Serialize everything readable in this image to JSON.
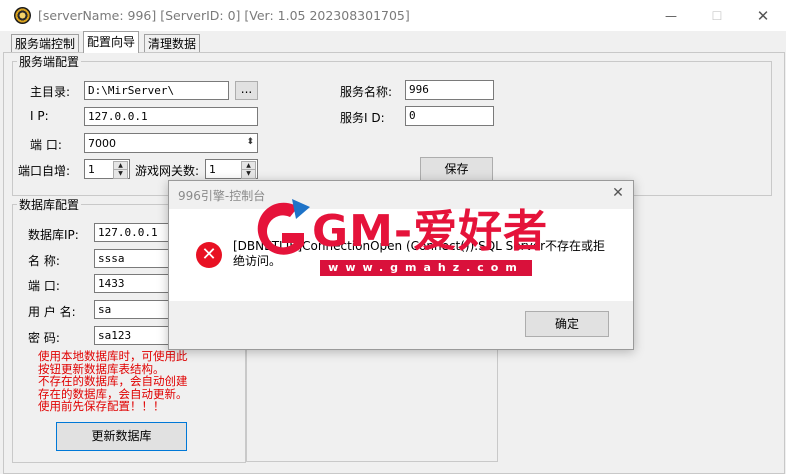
{
  "window": {
    "title": "[serverName: 996] [ServerID: 0] [Ver:  1.05 202308301705]",
    "minimize": "—",
    "maximize": "☐",
    "close": "✕"
  },
  "tabs": [
    "服务端控制",
    "配置向导",
    "清理数据"
  ],
  "server_group": {
    "title": "服务端配置",
    "home_label": "主目录:",
    "home_value": "D:\\MirServer\\",
    "browse_label": "...",
    "ip_label": "I    P:",
    "ip_value": "127.0.0.1",
    "port_label": "端   口:",
    "port_value": "7000",
    "port_inc_label": "端口自增:",
    "port_inc_value": "1",
    "gate_label": "游戏网关数:",
    "gate_value": "1",
    "name_label": "服务名称:",
    "name_value": "996",
    "id_label": "服务I  D:",
    "id_value": "0",
    "save_label": "保存"
  },
  "db_group": {
    "title": "数据库配置",
    "ip_label": "数据库IP:",
    "ip_value": "127.0.0.1",
    "name_label": "名    称:",
    "name_value": "sssa",
    "port_label": "端     口:",
    "port_value": "1433",
    "user_label": "用 户 名:",
    "user_value": "sa",
    "pwd_label": "密    码:",
    "pwd_value": "sa123",
    "warning": [
      "使用本地数据库时，可使用此",
      "按钮更新数据库表结构。",
      "不存在的数据库，会自动创建",
      "存在的数据库，会自动更新。",
      "使用前先保存配置！！！"
    ],
    "update_label": "更新数据库"
  },
  "dialog": {
    "title": "996引擎-控制台",
    "close": "✕",
    "message": "[DBNETLIB]ConnectionOpen (Connect()).SQL Server不存在或拒绝访问。",
    "ok_label": "确定"
  },
  "watermark": {
    "brand": "GM-爱好者",
    "url": "www.gmahz.com"
  },
  "colors": {
    "error": "#e81123",
    "warning_text": "#e00000",
    "watermark": "#e5133a"
  }
}
